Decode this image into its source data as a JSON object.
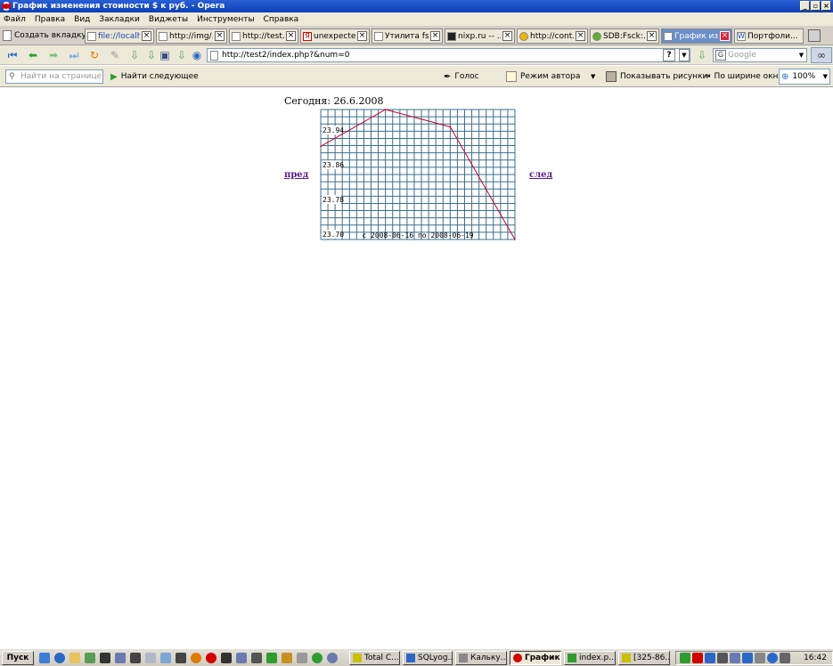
{
  "window": {
    "title": "График изменения стоиности $ к руб. - Opera"
  },
  "menu": [
    "Файл",
    "Правка",
    "Вид",
    "Закладки",
    "Виджеты",
    "Инструменты",
    "Справка"
  ],
  "tabs": {
    "new_tab_label": "Создать вкладку",
    "items": [
      {
        "label": "file://localh...",
        "active": false
      },
      {
        "label": "http://img/...",
        "active": false
      },
      {
        "label": "http://test...",
        "active": false
      },
      {
        "label": "unexpecte...",
        "active": false
      },
      {
        "label": "Утилита fsck",
        "active": false
      },
      {
        "label": "nixp.ru -- ...",
        "active": false
      },
      {
        "label": "http://cont...",
        "active": false
      },
      {
        "label": "SDB:Fsck:...",
        "active": false
      },
      {
        "label": "График из...",
        "active": true
      },
      {
        "label": "Портфоли...",
        "active": false
      }
    ]
  },
  "address_bar": {
    "url": "http://test2/index.php?&num=0",
    "search_placeholder": "Google"
  },
  "findbar": {
    "find_placeholder": "Найти на странице",
    "find_next": "Найти следующее",
    "voice": "Голос",
    "author_mode": "Режим автора",
    "show_images": "Показывать рисунки",
    "fit_width": "По ширине окна",
    "zoom": "100%"
  },
  "page": {
    "today": "Сегодня: 26.6.2008",
    "prev_link": "пред",
    "next_link": "след"
  },
  "chart_data": {
    "type": "line",
    "range_label": "с 2008-06-16 по 2008-06-19",
    "ylim": [
      23.7,
      24.0
    ],
    "yticks": [
      23.7,
      23.78,
      23.86,
      23.94
    ],
    "ytick_labels": [
      "23.70",
      "23.78",
      "23.86",
      "23.94"
    ],
    "x": [
      0,
      1,
      2,
      3
    ],
    "series": [
      {
        "values": [
          23.915,
          24.0,
          23.96,
          23.7
        ],
        "color": "#c8002a"
      }
    ],
    "grid": true,
    "grid_color": "#3b6f8f"
  },
  "taskbar": {
    "start": "Пуск",
    "tasks": [
      {
        "label": "Total C...",
        "active": false
      },
      {
        "label": "SQLyog...",
        "active": false
      },
      {
        "label": "Кальку...",
        "active": false
      },
      {
        "label": "График...",
        "active": true
      },
      {
        "label": "index.p...",
        "active": false
      },
      {
        "label": "[325-86...",
        "active": false
      }
    ],
    "clock": "16:42"
  }
}
